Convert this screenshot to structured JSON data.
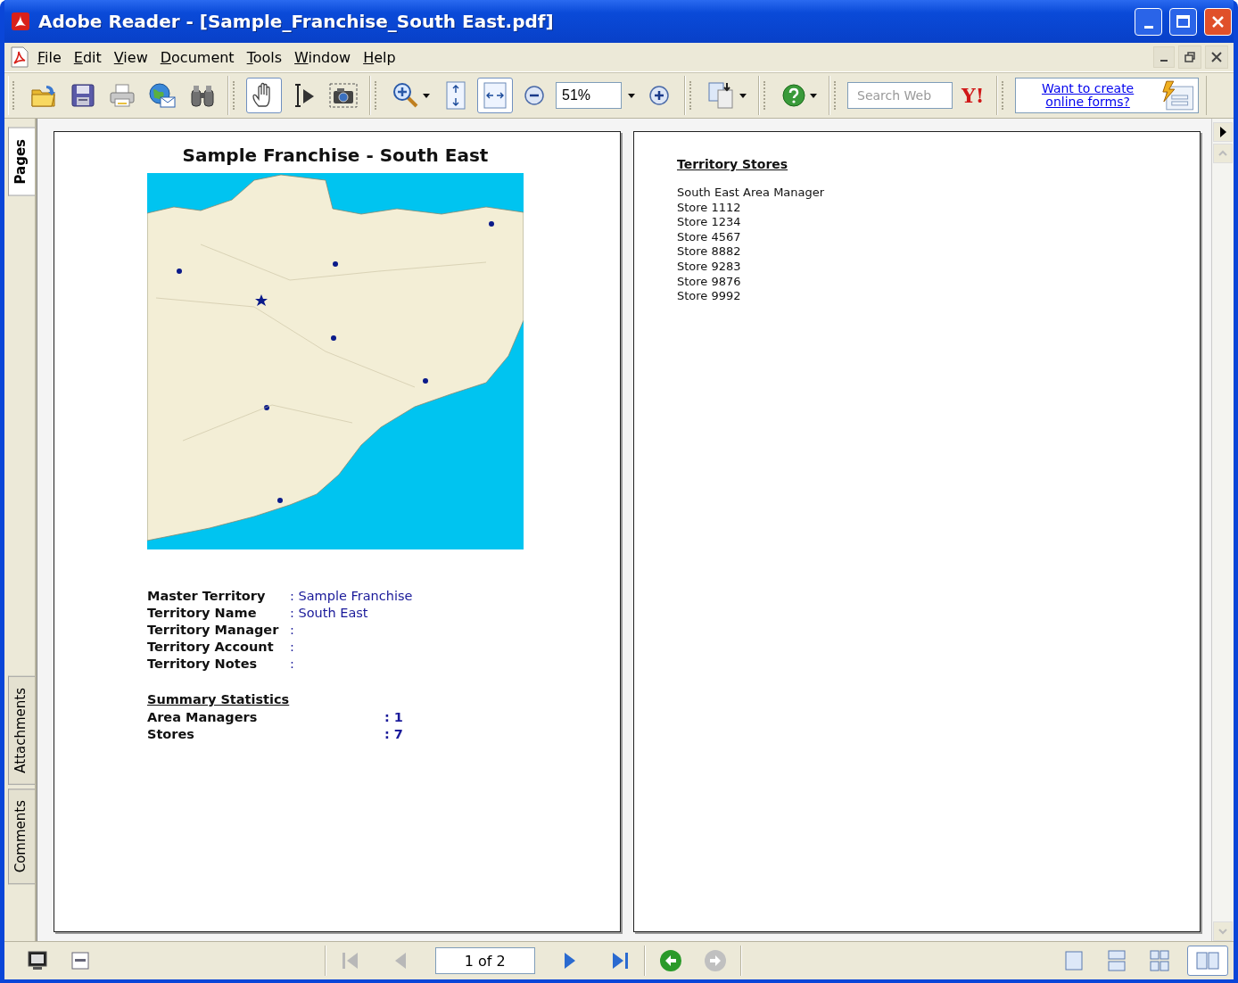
{
  "window": {
    "title": "Adobe Reader - [Sample_Franchise_South East.pdf]"
  },
  "menu": [
    "File",
    "Edit",
    "View",
    "Document",
    "Tools",
    "Window",
    "Help"
  ],
  "toolbar": {
    "groups": [
      [
        {
          "kind": "open",
          "selected": false,
          "dropdown": false
        },
        {
          "kind": "save",
          "selected": false,
          "dropdown": false
        },
        {
          "kind": "print",
          "selected": false,
          "dropdown": false
        },
        {
          "kind": "email",
          "selected": false,
          "dropdown": false
        },
        {
          "kind": "find",
          "selected": false,
          "dropdown": false
        }
      ],
      [
        {
          "kind": "hand",
          "selected": true,
          "dropdown": false
        },
        {
          "kind": "select",
          "selected": false,
          "dropdown": false
        },
        {
          "kind": "snapshot",
          "selected": false,
          "dropdown": false
        }
      ],
      [
        {
          "kind": "zoom_in",
          "selected": false,
          "dropdown": true
        },
        {
          "kind": "fit_page",
          "selected": false,
          "dropdown": false
        },
        {
          "kind": "fit_width",
          "selected": true,
          "dropdown": false
        },
        {
          "kind": "zoom_out",
          "selected": false,
          "dropdown": false
        },
        {
          "kind": "zoom_field",
          "value": "51%",
          "dropdown": true
        },
        {
          "kind": "zoom_plus",
          "selected": false,
          "dropdown": false
        }
      ],
      [
        {
          "kind": "pages",
          "selected": false,
          "dropdown": true
        }
      ],
      [
        {
          "kind": "help",
          "selected": false,
          "dropdown": true
        }
      ],
      [
        {
          "kind": "search_field",
          "placeholder": "Search Web"
        },
        {
          "kind": "logo",
          "text": "Y!"
        }
      ],
      [
        {
          "kind": "promo",
          "text": "Want to create online forms?"
        }
      ]
    ]
  },
  "side_tabs": [
    {
      "label": "Pages",
      "selected": true
    },
    {
      "label": "Attachments",
      "selected": false
    },
    {
      "label": "Comments",
      "selected": false
    }
  ],
  "pages": [
    {
      "kind": "summary",
      "title": "Sample Franchise - South East",
      "fields": [
        {
          "label": "Master Territory",
          "value": ": Sample Franchise"
        },
        {
          "label": "Territory Name",
          "value": ": South East"
        },
        {
          "label": "Territory Manager",
          "value": ":"
        },
        {
          "label": "Territory Account",
          "value": ":"
        },
        {
          "label": "Territory Notes",
          "value": ":"
        }
      ],
      "stats_heading": "Summary Statistics",
      "stats": [
        {
          "label": "Area Managers",
          "value": ": 1"
        },
        {
          "label": "Stores",
          "value": ": 7"
        }
      ]
    },
    {
      "kind": "list",
      "heading": "Territory Stores",
      "lines": [
        "South East Area Manager",
        "Store 1112",
        "Store 1234",
        "Store 4567",
        "Store 8882",
        "Store 9283",
        "Store 9876",
        "Store 9992"
      ]
    }
  ],
  "status_bar": {
    "left": [
      {
        "kind": "full_screen"
      },
      {
        "kind": "panel"
      }
    ],
    "navigation": [
      {
        "kind": "first",
        "disabled": true
      },
      {
        "kind": "previous",
        "disabled": true
      },
      {
        "kind": "page_field",
        "value": "1 of 2"
      },
      {
        "kind": "next",
        "disabled": false
      },
      {
        "kind": "last",
        "disabled": false
      }
    ],
    "history": [
      {
        "kind": "back",
        "disabled": false
      },
      {
        "kind": "forward",
        "disabled": true
      }
    ],
    "layouts": [
      {
        "kind": "single",
        "selected": false
      },
      {
        "kind": "continuous",
        "selected": false
      },
      {
        "kind": "continuous_facing",
        "selected": false
      },
      {
        "kind": "facing",
        "selected": true
      }
    ]
  }
}
